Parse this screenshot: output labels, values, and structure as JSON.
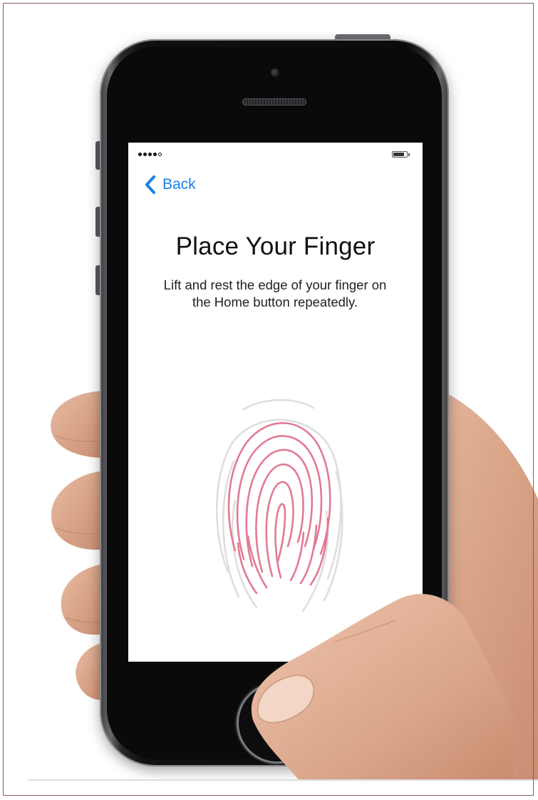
{
  "status_bar": {
    "signal_icon": "signal-dots-icon",
    "battery_icon": "battery-icon"
  },
  "nav": {
    "back_label": "Back",
    "back_icon": "chevron-left-icon"
  },
  "content": {
    "title": "Place Your Finger",
    "instruction": "Lift and rest the edge of your finger on the Home button repeatedly.",
    "fingerprint_icon": "fingerprint-icon"
  },
  "colors": {
    "accent": "#1a82e6",
    "fingerprint_active": "#e27a93",
    "fingerprint_inactive": "#dedede"
  }
}
